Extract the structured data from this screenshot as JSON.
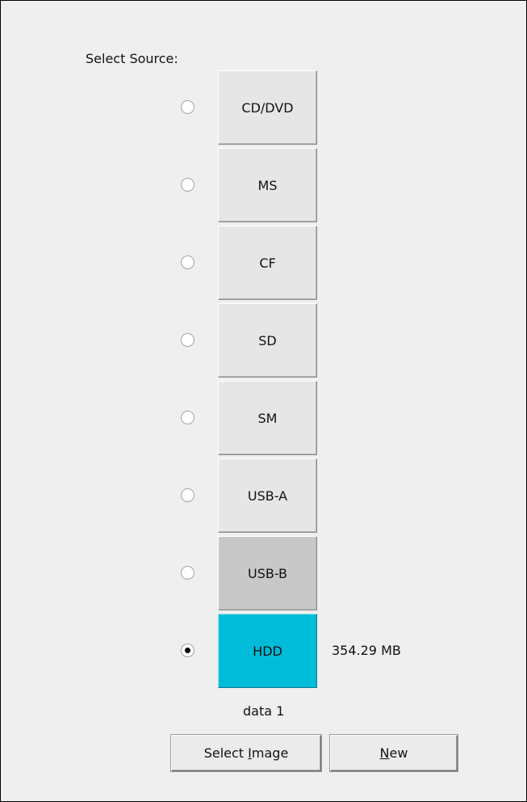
{
  "panel": {
    "title": "Select Source:",
    "sources": [
      {
        "label": "CD/DVD",
        "selected": false
      },
      {
        "label": "MS",
        "selected": false
      },
      {
        "label": "CF",
        "selected": false
      },
      {
        "label": "SD",
        "selected": false
      },
      {
        "label": "SM",
        "selected": false
      },
      {
        "label": "USB-A",
        "selected": false
      },
      {
        "label": "USB-B",
        "selected": false
      },
      {
        "label": "HDD",
        "selected": true,
        "size": "354.29 MB"
      }
    ],
    "image_name": "data 1",
    "buttons": {
      "select_image": {
        "pre": "Select ",
        "mnemonic": "I",
        "post": "mage"
      },
      "new": {
        "pre": "",
        "mnemonic": "N",
        "post": "ew"
      }
    },
    "colors": {
      "selected_source": "#00bcd8",
      "hover_source": "#c8c8c8",
      "panel_bg": "#efefef"
    }
  }
}
